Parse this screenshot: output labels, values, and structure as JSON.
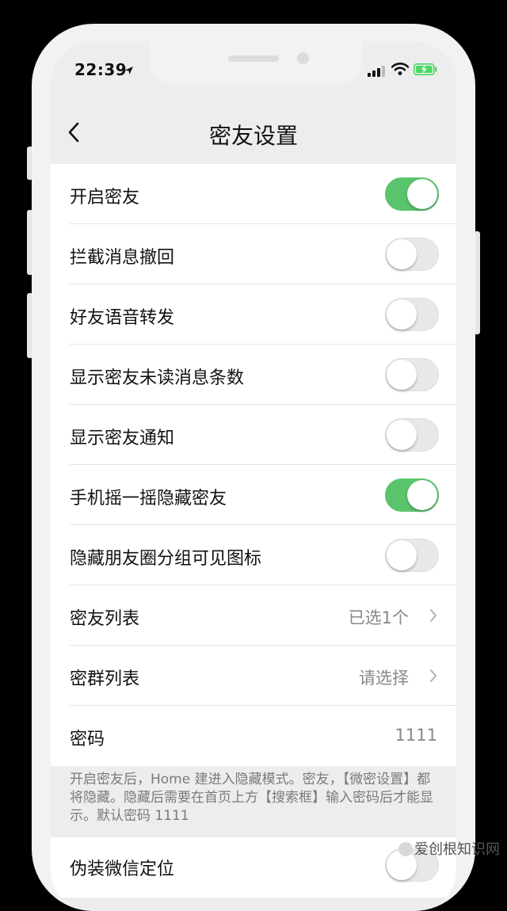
{
  "status": {
    "time": "22:39"
  },
  "nav": {
    "title": "密友设置"
  },
  "settings": [
    {
      "label": "开启密友",
      "on": true
    },
    {
      "label": "拦截消息撤回",
      "on": false
    },
    {
      "label": "好友语音转发",
      "on": false
    },
    {
      "label": "显示密友未读消息条数",
      "on": false
    },
    {
      "label": "显示密友通知",
      "on": false
    },
    {
      "label": "手机摇一摇隐藏密友",
      "on": true
    },
    {
      "label": "隐藏朋友圈分组可见图标",
      "on": false
    }
  ],
  "friend_list": {
    "label": "密友列表",
    "value": "已选1个"
  },
  "group_list": {
    "label": "密群列表",
    "value": "请选择"
  },
  "password": {
    "label": "密码",
    "value": "1111"
  },
  "note": "开启密友后，Home 建进入隐藏模式。密友，【微密设置】都将隐藏。隐藏后需要在首页上方【搜索框】输入密码后才能显示。默认密码 1111",
  "location": {
    "label": "伪装微信定位",
    "on": false
  },
  "watermark": "爱创根知识网",
  "colors": {
    "toggle_on": "#5ac46c",
    "toggle_off": "#e8e8e8",
    "background": "#ededed"
  }
}
